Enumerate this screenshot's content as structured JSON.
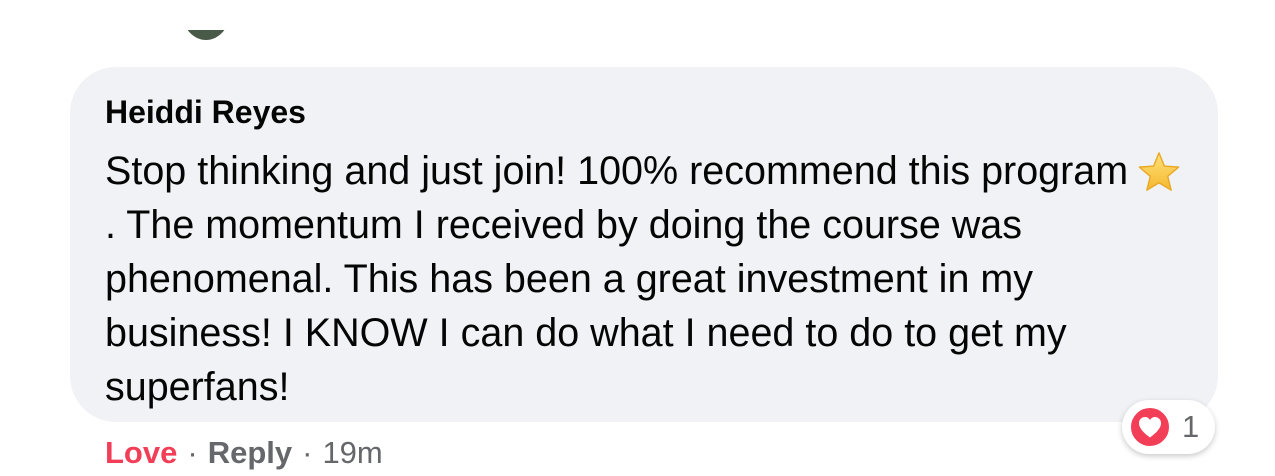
{
  "comment": {
    "author": "Heiddi Reyes",
    "text_part1": "Stop thinking and just join! 100% recommend this program",
    "text_part2": ". The momentum I received by doing the course was phenomenal. This has been a great investment in my business! I KNOW I can do what I need to do to get my superfans!",
    "emoji": "star-icon"
  },
  "reactions": {
    "icon": "heart-icon",
    "count": "1",
    "color": "#f33e58"
  },
  "actions": {
    "love_label": "Love",
    "separator": "·",
    "reply_label": "Reply",
    "timestamp": "19m"
  },
  "colors": {
    "bubble_bg": "#f0f2f5",
    "text": "#050505",
    "secondary_text": "#65676b",
    "love": "#f33e58"
  }
}
